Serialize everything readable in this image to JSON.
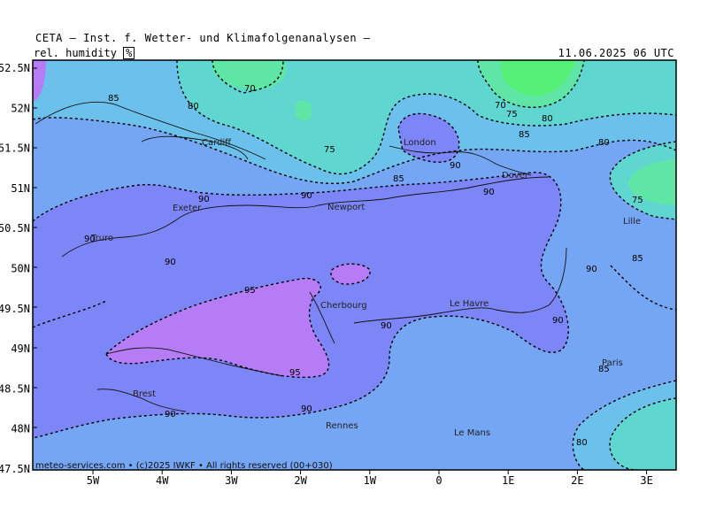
{
  "header": {
    "title": "CETA — Inst. f. Wetter- und Klimafolgenanalysen —",
    "parameter": "rel. humidity",
    "unit": "%",
    "timestamp": "11.06.2025 06 UTC"
  },
  "footer": "meteo-services.com • (c)2025 IWKF • All rights reserved (00+030)",
  "axes": {
    "latitudes": [
      "52.5N",
      "52N",
      "51.5N",
      "51N",
      "50.5N",
      "50N",
      "49.5N",
      "49N",
      "48.5N",
      "48N",
      "47.5N"
    ],
    "longitudes": [
      "5W",
      "4W",
      "3W",
      "2W",
      "1W",
      "0",
      "1E",
      "2E",
      "3E"
    ]
  },
  "cities": [
    "Cardiff",
    "London",
    "Dover",
    "Exeter",
    "Newport",
    "Truro",
    "Lille",
    "Le Havre",
    "Cherbourg",
    "Paris",
    "Brest",
    "Rennes",
    "Le Mans"
  ],
  "contour_labels": [
    "70",
    "80",
    "85",
    "75",
    "70",
    "75",
    "80",
    "85",
    "90",
    "80",
    "75",
    "85",
    "90",
    "90",
    "90",
    "90",
    "90",
    "90",
    "90",
    "85",
    "95",
    "90",
    "95",
    "90",
    "85",
    "90",
    "80"
  ],
  "colors": {
    "rh_95": "#b67cf6",
    "rh_90": "#7d86f6",
    "rh_85": "#74a6f4",
    "rh_80": "#6cc0ec",
    "rh_75": "#5fd6cf",
    "rh_70": "#5fe6a6",
    "rh_65": "#56f078"
  }
}
